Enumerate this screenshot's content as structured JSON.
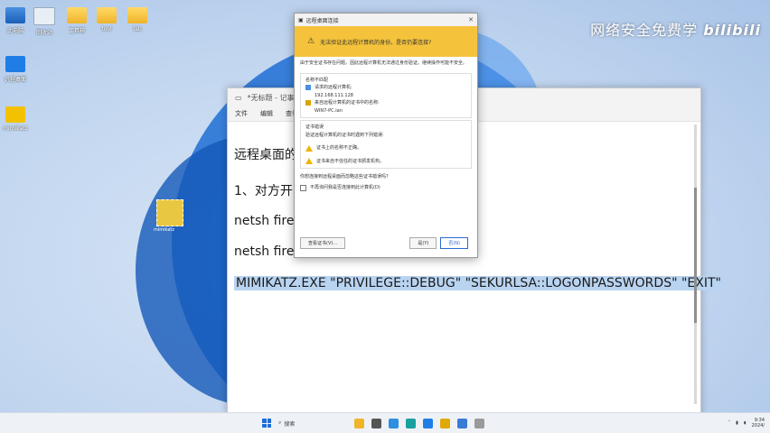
{
  "watermark": {
    "text": "网络安全免费学",
    "brand": "bilibili"
  },
  "desktop": {
    "icons": [
      {
        "label": "此电脑",
        "kind": "pc"
      },
      {
        "label": "回收站",
        "kind": "bin"
      },
      {
        "label": "工具箱",
        "kind": "folder"
      },
      {
        "label": "tool",
        "kind": "folder"
      },
      {
        "label": "lab",
        "kind": "folder"
      },
      {
        "label": "远程桌面",
        "kind": "app1"
      },
      {
        "label": "mimikatz",
        "kind": "app2"
      }
    ],
    "mid_icon_label": "mimikatz"
  },
  "notepad": {
    "title": "*无标题 - 记事本",
    "menu": [
      "文件",
      "编辑",
      "查看"
    ],
    "lines": [
      "远程桌面的",
      "1、对方开",
      "netsh firew",
      "netsh firewall set opmode disable",
      "MIMIKATZ.EXE \"PRIVILEGE::DEBUG\" \"SEKURLSA::LOGONPASSWORDS\" \"EXIT\""
    ]
  },
  "dialog": {
    "title": "远程桌面连接",
    "close": "✕",
    "warning": "无法验证此远程计算机的身份。是否仍要连接?",
    "intro": "由于安全证书存在问题，因此远程计算机无法通过身份验证。继续操作可能不安全。",
    "name_mismatch": {
      "heading": "名称不匹配",
      "requested_label": "请求的远程计算机:",
      "requested_value": "192.168.111.128",
      "cert_label": "来自远程计算机的证书中的名称:",
      "cert_value": "WIN7-PC.lan"
    },
    "cert_errors": {
      "heading": "证书错误",
      "intro": "验证远程计算机的证书时遇到下列错误:",
      "errors": [
        "证书上的名称不正确。",
        "证书来自不信任的证书颁发机构。"
      ]
    },
    "question": "你想连接到远程桌面而忽略这些证书错误吗?",
    "dont_ask": "不再询问我是否连接到此计算机(D)",
    "view_cert_button": "查看证书(V)...",
    "yes_button": "是(Y)",
    "no_button": "否(N)"
  },
  "taskbar": {
    "search": "搜索",
    "clock_time": "9:34",
    "clock_date": "2024/"
  }
}
